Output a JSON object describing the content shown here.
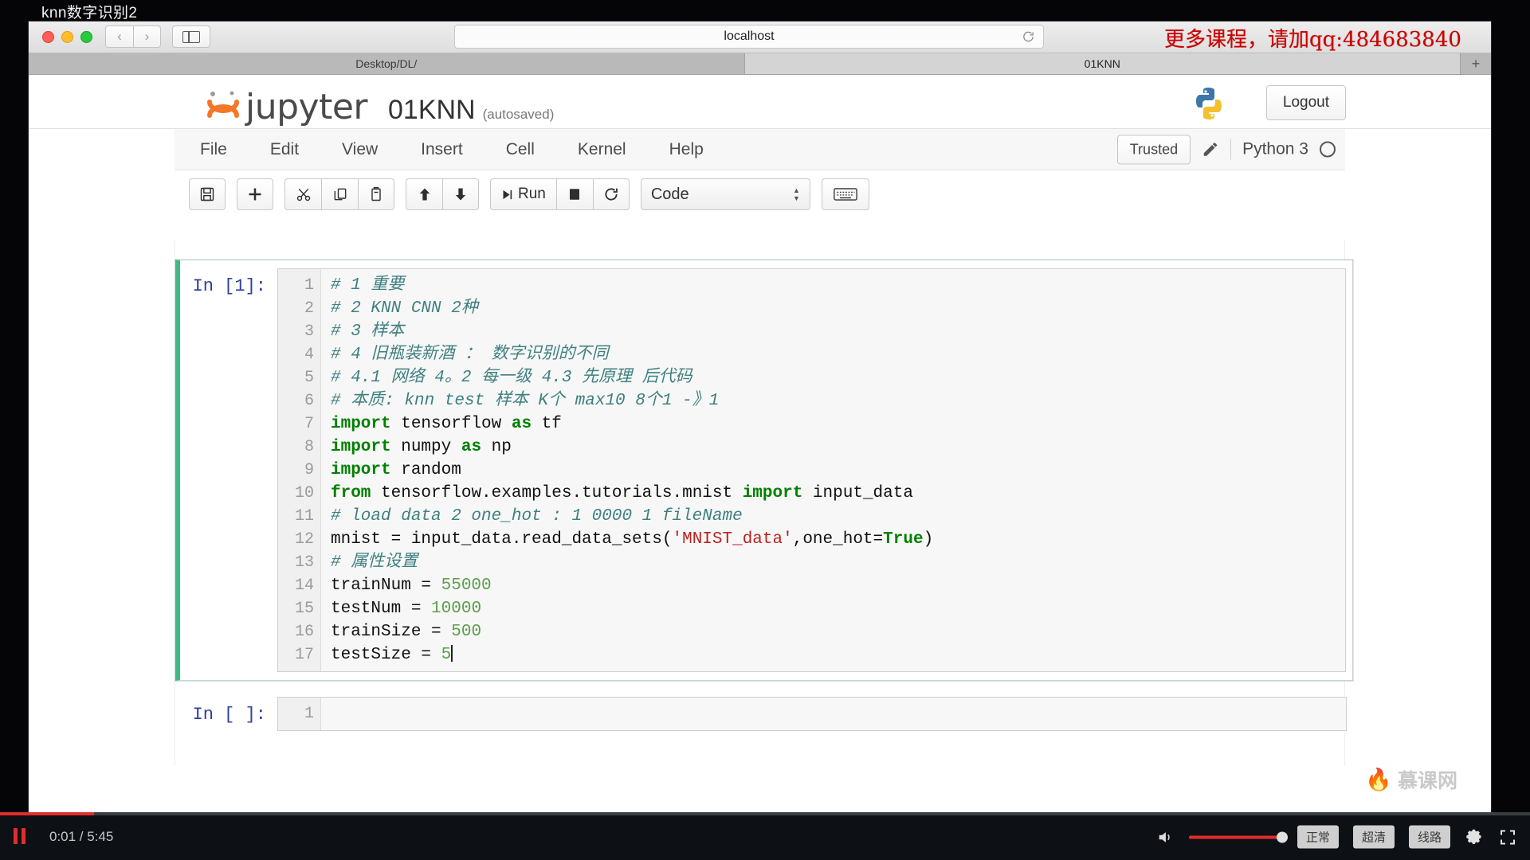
{
  "video": {
    "title": "knn数字识别2",
    "time_current": "0:01",
    "time_total": "5:45",
    "time_label": "0:01 / 5:45",
    "pause_icon": "pause-icon",
    "volume_icon": "volume-icon",
    "quality_buttons": [
      "正常",
      "超清",
      "线路"
    ],
    "settings_icon": "gear-icon",
    "fullscreen_icon": "fullscreen-icon",
    "progress_percent": 6,
    "volume_percent": 100
  },
  "browser": {
    "back_icon": "chevron-left-icon",
    "forward_icon": "chevron-right-icon",
    "sidebar_icon": "sidebar-toggle-icon",
    "url": "localhost",
    "reload_icon": "reload-icon",
    "promo": "更多课程，请加qq:484683840",
    "tabs": [
      {
        "label": "Desktop/DL/",
        "active": false
      },
      {
        "label": "01KNN",
        "active": true
      }
    ],
    "new_tab_icon": "plus-icon"
  },
  "jupyter": {
    "logo_icon": "jupyter-logo-icon",
    "logo_word": "jupyter",
    "notebook_name": "01KNN",
    "save_status": "(autosaved)",
    "python_logo_icon": "python-logo-icon",
    "logout_label": "Logout",
    "menu": [
      "File",
      "Edit",
      "View",
      "Insert",
      "Cell",
      "Kernel",
      "Help"
    ],
    "trusted_label": "Trusted",
    "edit_mode_icon": "pencil-icon",
    "kernel_name": "Python 3",
    "kernel_status_icon": "kernel-idle-circle-icon",
    "toolbar": {
      "save_icon": "save-floppy-icon",
      "insert_icon": "plus-icon",
      "cut_icon": "scissors-icon",
      "copy_icon": "copy-icon",
      "paste_icon": "paste-icon",
      "move_up_icon": "arrow-up-icon",
      "move_down_icon": "arrow-down-icon",
      "run_label": "Run",
      "run_icon": "run-icon",
      "stop_icon": "stop-square-icon",
      "restart_icon": "restart-circular-arrow-icon",
      "cell_type": "Code",
      "cell_type_caret_icon": "select-arrows-icon",
      "keyboard_icon": "command-palette-icon"
    }
  },
  "notebook": {
    "cells": [
      {
        "prompt": "In [1]:",
        "selected": true,
        "line_numbers": [
          "1",
          "2",
          "3",
          "4",
          "5",
          "6",
          "7",
          "8",
          "9",
          "10",
          "11",
          "12",
          "13",
          "14",
          "15",
          "16",
          "17"
        ],
        "lines": [
          "# 1 重要",
          "# 2 KNN CNN 2种",
          "# 3 样本",
          "# 4 旧瓶装新酒 ： 数字识别的不同",
          "# 4.1 网络 4。2 每一级 4.3 先原理 后代码",
          "# 本质: knn test 样本 K个 max10 8个1 -》1",
          "import tensorflow as tf",
          "import numpy as np",
          "import random",
          "from tensorflow.examples.tutorials.mnist import input_data",
          "# load data 2 one_hot : 1 0000 1 fileName",
          "mnist = input_data.read_data_sets('MNIST_data',one_hot=True)",
          "# 属性设置",
          "trainNum = 55000",
          "testNum = 10000",
          "trainSize = 500",
          "testSize = 5"
        ]
      },
      {
        "prompt": "In [ ]:",
        "selected": false,
        "line_numbers": [
          "1"
        ],
        "lines": [
          ""
        ]
      }
    ]
  },
  "watermark": {
    "text": "慕课网",
    "icon": "flame-icon"
  },
  "colors": {
    "accent_green": "#42b983",
    "comment": "#408080",
    "keyword": "#008000",
    "string": "#ba2121",
    "number": "#5a9e4a",
    "promo_red": "#cc0000",
    "player_red": "#e12d2d"
  }
}
